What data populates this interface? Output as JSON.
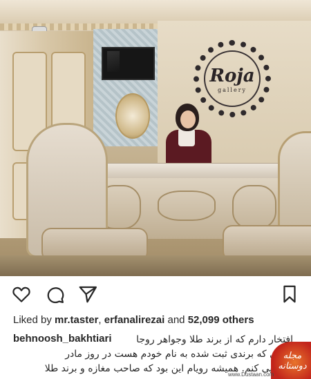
{
  "post": {
    "photo_logo_text": "Roja",
    "photo_logo_subtext": "gallery"
  },
  "actions": {
    "like_icon": "heart-icon",
    "comment_icon": "comment-icon",
    "share_icon": "send-icon",
    "save_icon": "bookmark-icon"
  },
  "likes": {
    "prefix": "Liked by",
    "user1": "mr.taster",
    "user2": "erfanalirezai",
    "and": "and",
    "count": "52,099 others"
  },
  "caption": {
    "username": "behnoosh_bakhtiari",
    "line1": "افتخار دارم که از برند طلا وجواهر روجا",
    "line2": "گالری که برندی ثبت شده به نام خودم هست در روز مادر",
    "line3": "رونمایی کنم. همیشه رویام این بود که صاحب مغازه و برند طلا"
  },
  "watermark": {
    "text": "مجله دوستانه",
    "url": "www.Dustaan.com"
  },
  "colors": {
    "text": "#262626",
    "background": "#ffffff"
  }
}
